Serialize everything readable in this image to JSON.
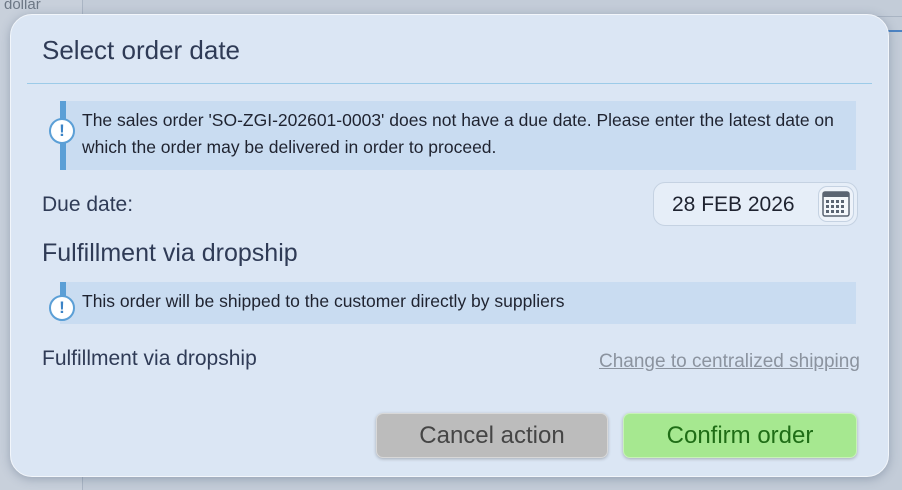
{
  "background": {
    "partial_text": "dollar"
  },
  "dialog": {
    "title": "Select order date",
    "info_due": "The sales order 'SO-ZGI-202601-0003' does not have a due date. Please enter the latest date on which the order may be delivered in order to proceed.",
    "due_date_label": "Due date:",
    "due_date_value": "28 FEB 2026",
    "fulfillment_title": "Fulfillment via dropship",
    "info_dropship": "This order will be shipped to the customer directly by suppliers",
    "fulfillment_label": "Fulfillment via dropship",
    "change_link": "Change to centralized shipping",
    "cancel_button": "Cancel action",
    "confirm_button": "Confirm order",
    "info_icon_glyph": "!"
  },
  "colors": {
    "dialog_bg": "#dbe6f4",
    "info_bg": "#c9dcf1",
    "accent_blue": "#5b9fd6",
    "cancel_bg": "#bcbcbc",
    "confirm_bg": "#a6e890",
    "confirm_text": "#1f6d16"
  },
  "icons": [
    "info-icon",
    "calendar-icon"
  ]
}
